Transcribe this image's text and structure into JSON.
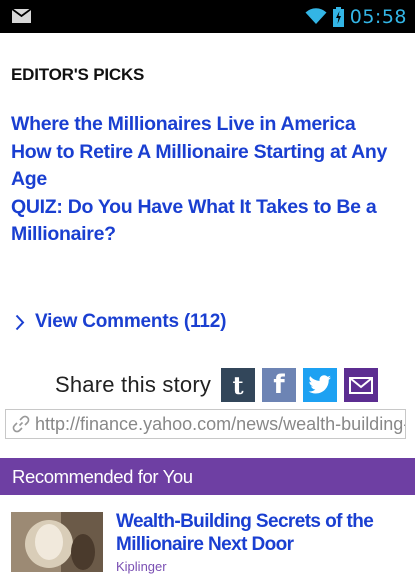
{
  "status_bar": {
    "time": "05:58"
  },
  "editors_picks": {
    "title": "EDITOR'S PICKS",
    "items": [
      "Where the Millionaires Live in America",
      "How to Retire A Millionaire Starting at Any Age",
      "QUIZ: Do You Have What It Takes to Be a Millionaire?"
    ]
  },
  "comments": {
    "label": "View Comments (112)"
  },
  "share": {
    "label": "Share this story",
    "buttons": [
      "tumblr-icon",
      "facebook-icon",
      "twitter-icon",
      "email-icon"
    ]
  },
  "url_field": {
    "value": "http://finance.yahoo.com/news/wealth-building-secrets"
  },
  "recommended": {
    "header": "Recommended for You",
    "items": [
      {
        "title": "Wealth-Building Secrets of the Millionaire Next Door",
        "source": "Kiplinger"
      }
    ]
  },
  "colors": {
    "link": "#1a3fd1",
    "accent_purple": "#6e3fa3",
    "status_icon": "#33b5e5"
  }
}
